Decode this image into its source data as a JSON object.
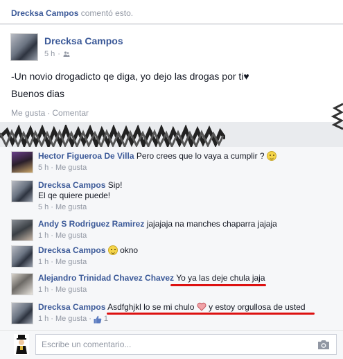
{
  "story": {
    "actor": "Drecksa Campos",
    "action": "comentó esto."
  },
  "post": {
    "author": "Drecksa Campos",
    "time": "5 h",
    "separator": "·",
    "lines": [
      "-Un novio drogadicto qe diga, yo dejo las drogas por ti♥",
      "Buenos dias"
    ],
    "like_label": "Me gusta",
    "dot": "·",
    "comment_label": "Comentar"
  },
  "comments": [
    {
      "name": "Hector Figueroa De Villa",
      "text": "Pero crees que lo vaya a cumplir ?",
      "emoji": "smile",
      "time": "5 h",
      "like": "Me gusta"
    },
    {
      "name": "Drecksa Campos",
      "text": "Sip!",
      "text2": "El qe quiere puede!",
      "time": "5 h",
      "like": "Me gusta"
    },
    {
      "name": "Andy S Rodriguez Ramirez",
      "text": "jajajaja na manches chaparra jajaja",
      "time": "1 h",
      "like": "Me gusta"
    },
    {
      "name": "Drecksa Campos",
      "text": "okno",
      "emoji": "smile",
      "time": "1 h",
      "like": "Me gusta"
    },
    {
      "name": "Alejandro Trinidad Chavez Chavez",
      "text": "Yo ya las deje chula jaja",
      "time": "1 h",
      "like": "Me gusta"
    },
    {
      "name": "Drecksa Campos",
      "text": "Asdfghjkl lo se mi chulo",
      "text_after": "y estoy orgullosa de usted",
      "time": "1 h",
      "like": "Me gusta",
      "like_count": "1"
    }
  ],
  "compose": {
    "placeholder": "Escribe un comentario..."
  },
  "colors": {
    "link": "#3b5998",
    "muted": "#9197a3",
    "underline": "#dd1111"
  }
}
